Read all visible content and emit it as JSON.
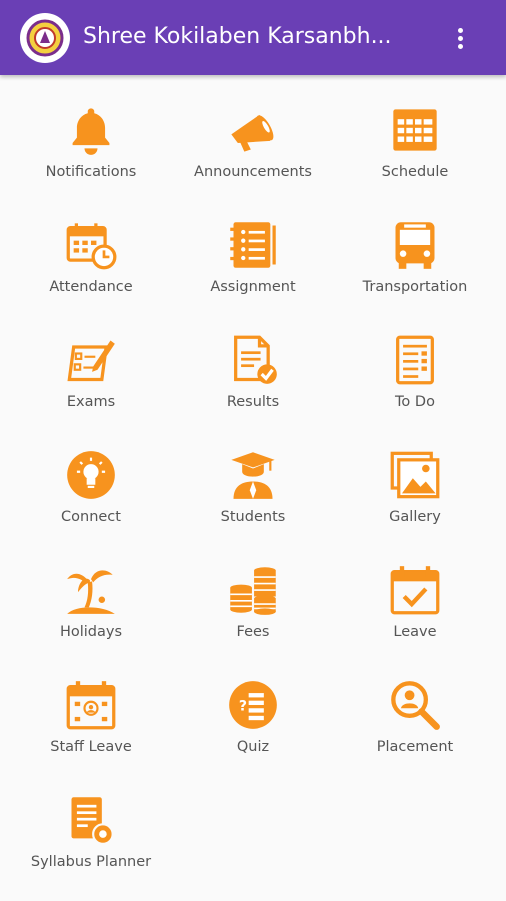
{
  "app": {
    "title": "Shree Kokilaben Karsanbh...",
    "colors": {
      "appbar": "#6a3fb5",
      "accent": "#f7931e",
      "background": "#fafafa"
    },
    "menu_icon": "more-vert-icon"
  },
  "grid": {
    "items": [
      {
        "label": "Notifications",
        "icon": "bell-icon"
      },
      {
        "label": "Announcements",
        "icon": "megaphone-icon"
      },
      {
        "label": "Schedule",
        "icon": "calendar-grid-icon"
      },
      {
        "label": "Attendance",
        "icon": "calendar-clock-icon"
      },
      {
        "label": "Assignment",
        "icon": "notebook-list-icon"
      },
      {
        "label": "Transportation",
        "icon": "bus-icon"
      },
      {
        "label": "Exams",
        "icon": "exam-sheet-icon"
      },
      {
        "label": "Results",
        "icon": "document-check-icon"
      },
      {
        "label": "To Do",
        "icon": "todo-list-icon"
      },
      {
        "label": "Connect",
        "icon": "lightbulb-icon"
      },
      {
        "label": "Students",
        "icon": "graduate-icon"
      },
      {
        "label": "Gallery",
        "icon": "gallery-icon"
      },
      {
        "label": "Holidays",
        "icon": "palm-tree-icon"
      },
      {
        "label": "Fees",
        "icon": "coins-icon"
      },
      {
        "label": "Leave",
        "icon": "calendar-check-icon"
      },
      {
        "label": "Staff Leave",
        "icon": "calendar-people-icon"
      },
      {
        "label": "Quiz",
        "icon": "quiz-icon"
      },
      {
        "label": "Placement",
        "icon": "search-person-icon"
      },
      {
        "label": "Syllabus Planner",
        "icon": "document-gear-icon"
      }
    ]
  }
}
